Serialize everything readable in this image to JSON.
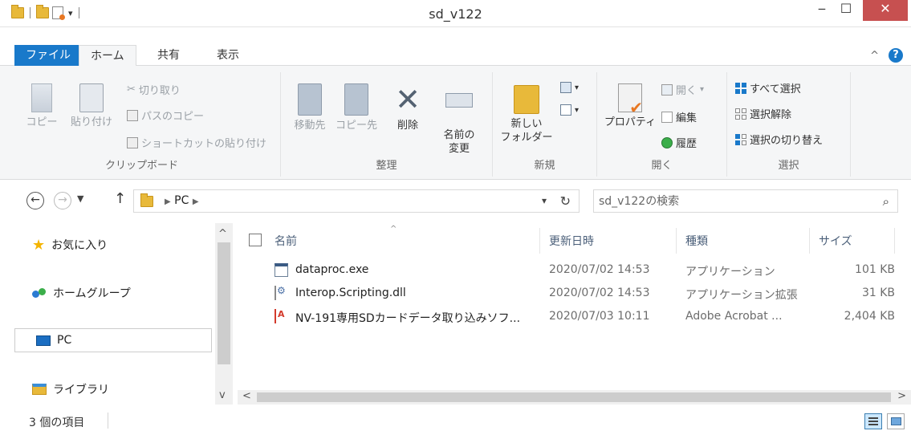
{
  "window": {
    "title": "sd_v122",
    "minimize": "‒",
    "maximize": "☐",
    "close": "✕"
  },
  "qat": {
    "dropdown": "▾"
  },
  "ribbon_tabs": {
    "file": "ファイル",
    "home": "ホーム",
    "share": "共有",
    "view": "表示",
    "collapse": "^",
    "help": "?"
  },
  "ribbon": {
    "clipboard": {
      "label": "クリップボード",
      "copy": "コピー",
      "paste": "貼り付け",
      "cut": "切り取り",
      "copy_path": "パスのコピー",
      "paste_shortcut": "ショートカットの貼り付け"
    },
    "organize": {
      "label": "整理",
      "move_to": "移動先",
      "copy_to": "コピー先",
      "delete": "削除",
      "rename_1": "名前の",
      "rename_2": "変更"
    },
    "new": {
      "label": "新規",
      "new_folder_1": "新しい",
      "new_folder_2": "フォルダー"
    },
    "open": {
      "label": "開く",
      "properties": "プロパティ",
      "open": "開く",
      "edit": "編集",
      "history": "履歴"
    },
    "select": {
      "label": "選択",
      "select_all": "すべて選択",
      "select_none": "選択解除",
      "invert": "選択の切り替え"
    }
  },
  "address": {
    "path": "PC",
    "search_placeholder": "sd_v122の検索"
  },
  "nav_pane": {
    "items": [
      {
        "label": "お気に入り"
      },
      {
        "label": "ホームグループ"
      },
      {
        "label": "PC"
      },
      {
        "label": "ライブラリ"
      }
    ]
  },
  "columns": {
    "name": "名前",
    "modified": "更新日時",
    "type": "種類",
    "size": "サイズ"
  },
  "files": [
    {
      "name": "dataproc.exe",
      "modified": "2020/07/02 14:53",
      "type": "アプリケーション",
      "size": "101 KB",
      "icon": "exe-icon"
    },
    {
      "name": "Interop.Scripting.dll",
      "modified": "2020/07/02 14:53",
      "type": "アプリケーション拡張",
      "size": "31 KB",
      "icon": "dll-icon"
    },
    {
      "name": "NV-191専用SDカードデータ取り込みソフ...",
      "modified": "2020/07/03 10:11",
      "type": "Adobe Acrobat ...",
      "size": "2,404 KB",
      "icon": "pdf-icon"
    }
  ],
  "status": {
    "item_count": "3 個の項目"
  }
}
